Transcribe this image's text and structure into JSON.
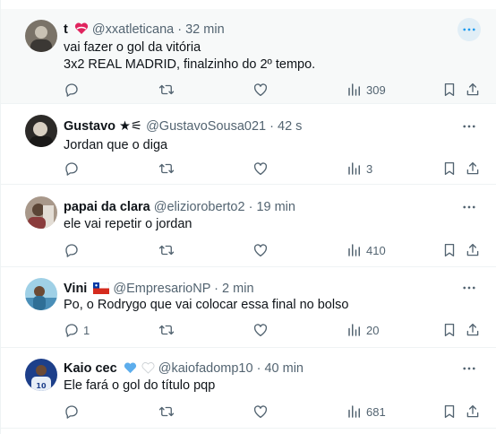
{
  "tweets": [
    {
      "name": "t",
      "handle": "@xxatleticana",
      "time": "32 min",
      "lines": [
        "vai fazer o gol da vitória",
        "3x2 REAL MADRID, finalzinho do 2º tempo."
      ],
      "reply_count": "",
      "view_count": "309",
      "name_emoji": "heart-ribbon",
      "avatar_colors": [
        "#7a7368",
        "#c9c2b4"
      ]
    },
    {
      "name": "Gustavo ★⚟",
      "handle": "@GustavoSousa021",
      "time": "42 s",
      "lines": [
        "Jordan que o diga"
      ],
      "reply_count": "",
      "view_count": "3",
      "avatar_colors": [
        "#2c2a28",
        "#d8cfc2"
      ]
    },
    {
      "name": "papai da clara",
      "handle": "@elizioroberto2",
      "time": "19 min",
      "lines": [
        "ele vai repetir o jordan"
      ],
      "reply_count": "",
      "view_count": "410",
      "avatar_colors": [
        "#5b4536",
        "#a8988a"
      ]
    },
    {
      "name": "Vini",
      "handle": "@EmpresarioNP",
      "time": "2 min",
      "lines": [
        "Po, o Rodrygo que vai colocar essa final no bolso"
      ],
      "reply_count": "1",
      "view_count": "20",
      "name_emoji": "chile-flag",
      "avatar_colors": [
        "#4a8fb8",
        "#9fd0e6"
      ]
    },
    {
      "name": "Kaio cec",
      "handle": "@kaiofadomp10",
      "time": "40 min",
      "lines": [
        "Ele fará o gol do título pqp"
      ],
      "reply_count": "",
      "view_count": "681",
      "name_emoji": "blue-heart white-heart",
      "avatar_colors": [
        "#1d3f8a",
        "#e7eef7"
      ]
    }
  ],
  "dot_separator": "·",
  "icons": {
    "more": "more-horizontal-icon",
    "reply": "reply-icon",
    "retweet": "retweet-icon",
    "like": "like-icon",
    "views": "views-icon",
    "bookmark": "bookmark-icon",
    "share": "share-icon"
  },
  "colors": {
    "text": "#0f1419",
    "secondary": "#536471",
    "divider": "#eff3f4",
    "highlight_bg": "#f7f9f9",
    "accent": "#1d9bf0"
  }
}
